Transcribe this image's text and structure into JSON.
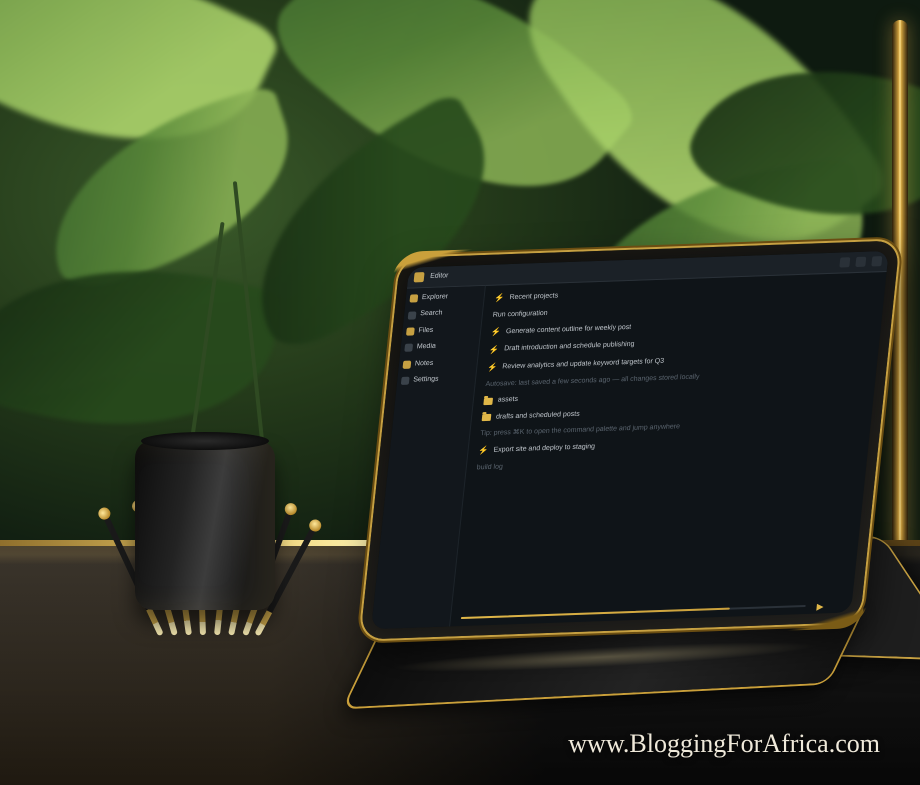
{
  "watermark": "www.BloggingForAfrica.com",
  "screen": {
    "app_label": "Editor",
    "titlebar_actions": [
      "min",
      "max",
      "close"
    ],
    "sidebar": {
      "items": [
        {
          "label": "Explorer",
          "muted": false
        },
        {
          "label": "Search",
          "muted": true
        },
        {
          "label": "Files",
          "muted": false
        },
        {
          "label": "Media",
          "muted": true
        },
        {
          "label": "Notes",
          "muted": false
        },
        {
          "label": "Settings",
          "muted": true
        }
      ]
    },
    "main": {
      "rows": [
        {
          "kind": "bolt",
          "text": "Recent projects"
        },
        {
          "kind": "text",
          "text": "Run configuration"
        },
        {
          "kind": "bolt",
          "text": "Generate content outline for weekly post"
        },
        {
          "kind": "bolt",
          "text": "Draft introduction and schedule publishing"
        },
        {
          "kind": "bolt",
          "text": "Review analytics and update keyword targets for Q3"
        },
        {
          "kind": "text",
          "text": "Autosave: last saved a few seconds ago — all changes stored locally"
        },
        {
          "kind": "folder",
          "text": "assets"
        },
        {
          "kind": "folder",
          "text": "drafts and scheduled posts"
        },
        {
          "kind": "text",
          "text": "Tip: press ⌘K to open the command palette and jump anywhere"
        },
        {
          "kind": "bolt",
          "text": "Export site and deploy to staging"
        },
        {
          "kind": "dim",
          "text": "build log"
        }
      ],
      "progress_pct": 78
    }
  }
}
